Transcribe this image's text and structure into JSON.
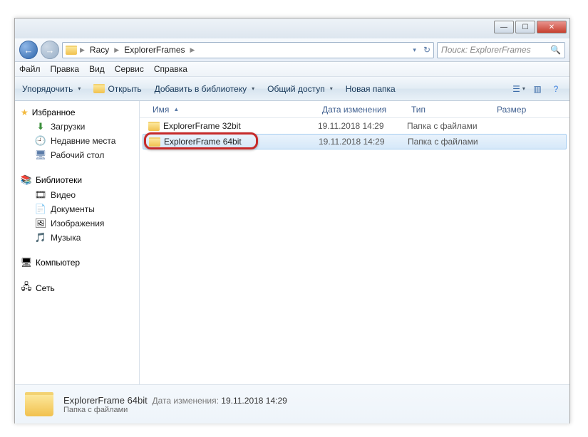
{
  "titlebar": {},
  "nav": {
    "crumbs": [
      "Racy",
      "ExplorerFrames"
    ]
  },
  "search": {
    "placeholder": "Поиск: ExplorerFrames"
  },
  "menu": [
    "Файл",
    "Правка",
    "Вид",
    "Сервис",
    "Справка"
  ],
  "toolbar": {
    "organize": "Упорядочить",
    "open": "Открыть",
    "library": "Добавить в библиотеку",
    "share": "Общий доступ",
    "newfolder": "Новая папка"
  },
  "sidebar": {
    "favorites": {
      "label": "Избранное",
      "items": [
        {
          "icon": "⬇",
          "label": "Загрузки"
        },
        {
          "icon": "🕘",
          "label": "Недавние места"
        },
        {
          "icon": "🖥",
          "label": "Рабочий стол"
        }
      ]
    },
    "libraries": {
      "label": "Библиотеки",
      "items": [
        {
          "icon": "🎞",
          "label": "Видео"
        },
        {
          "icon": "📄",
          "label": "Документы"
        },
        {
          "icon": "🖼",
          "label": "Изображения"
        },
        {
          "icon": "🎵",
          "label": "Музыка"
        }
      ]
    },
    "computer": {
      "label": "Компьютер"
    },
    "network": {
      "label": "Сеть"
    }
  },
  "columns": {
    "name": "Имя",
    "date": "Дата изменения",
    "type": "Тип",
    "size": "Размер"
  },
  "rows": [
    {
      "name": "ExplorerFrame 32bit",
      "date": "19.11.2018 14:29",
      "type": "Папка с файлами",
      "size": ""
    },
    {
      "name": "ExplorerFrame 64bit",
      "date": "19.11.2018 14:29",
      "type": "Папка с файлами",
      "size": ""
    }
  ],
  "details": {
    "title": "ExplorerFrame 64bit",
    "type": "Папка с файлами",
    "meta_label": "Дата изменения:",
    "meta_value": "19.11.2018 14:29"
  }
}
